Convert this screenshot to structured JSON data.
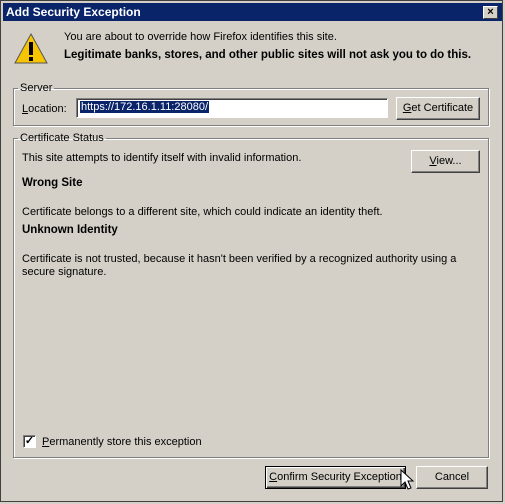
{
  "window": {
    "title": "Add Security Exception",
    "close_glyph": "×"
  },
  "intro": {
    "line1": "You are about to override how Firefox identifies this site.",
    "line2": "Legitimate banks, stores, and other public sites will not ask you to do this.",
    "icon": "warning-icon"
  },
  "server": {
    "legend": "Server",
    "location_label_u": "L",
    "location_label_rest": "ocation:",
    "location_value": "https://172.16.1.11:28080/",
    "get_cert_u": "G",
    "get_cert_rest": "et Certificate"
  },
  "status": {
    "legend": "Certificate Status",
    "summary": "This site attempts to identify itself with invalid information.",
    "view_u": "V",
    "view_rest": "iew...",
    "wrong_site_title": "Wrong Site",
    "wrong_site_desc": "Certificate belongs to a different site, which could indicate an identity theft.",
    "unknown_title": "Unknown Identity",
    "unknown_desc_1": "Certificate is not trusted, because it hasn't been verified by a recognized authority using a",
    "unknown_desc_2": "secure signature."
  },
  "options": {
    "permanent_checked": true,
    "check_glyph": "✓",
    "permanent_u": "P",
    "permanent_rest": "ermanently store this exception"
  },
  "buttons": {
    "confirm_u": "C",
    "confirm_rest": "onfirm Security Exception",
    "cancel": "Cancel"
  },
  "colors": {
    "titlebar": "#0a246a",
    "face": "#d4d0c8",
    "selection": "#0a246a"
  }
}
